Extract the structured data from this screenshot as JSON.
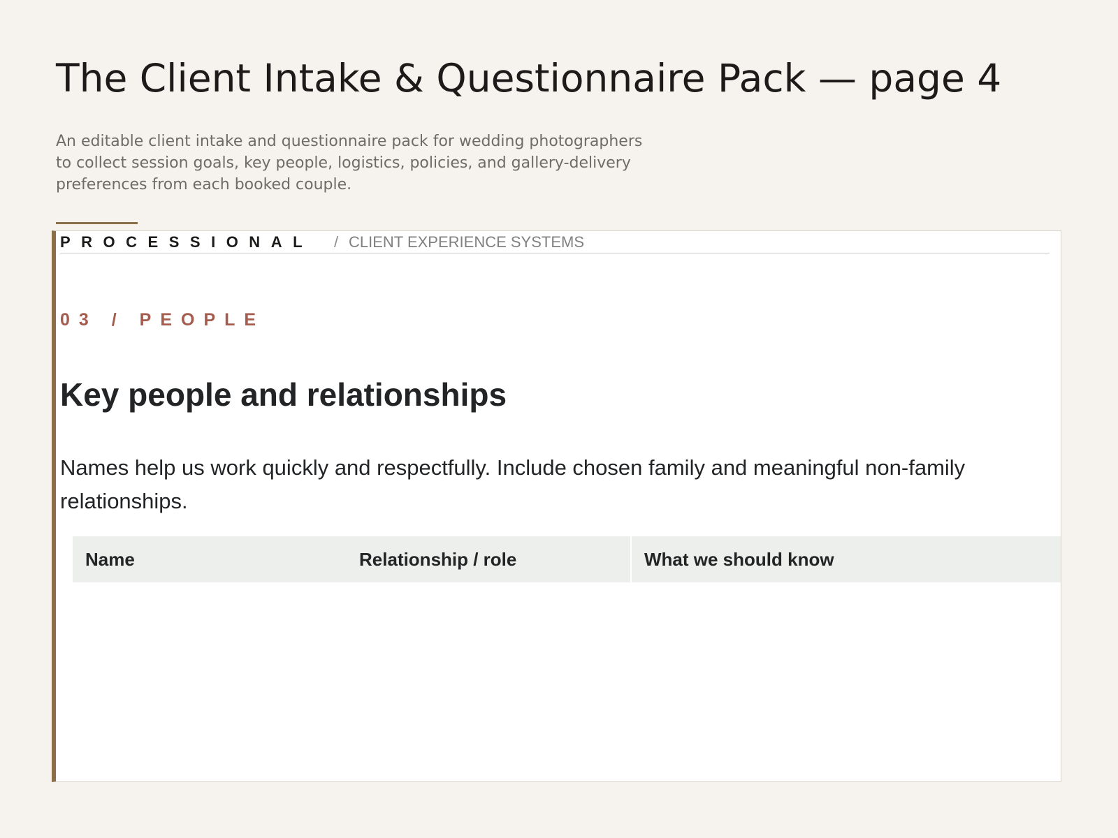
{
  "page": {
    "title": "The Client Intake & Questionnaire Pack — page 4",
    "description": "An editable client intake and questionnaire pack for wedding photographers to collect session goals, key people, logistics, policies, and gallery-delivery preferences from each booked couple."
  },
  "brand": {
    "name": "PROCESSIONAL",
    "separator": "/",
    "tagline": "CLIENT EXPERIENCE SYSTEMS"
  },
  "section": {
    "kicker": "03 / PEOPLE",
    "heading": "Key people and relationships",
    "intro": "Names help us work quickly and respectfully. Include chosen family and meaningful non-family relationships."
  },
  "table": {
    "columns": [
      "Name",
      "Relationship / role",
      "What we should know"
    ]
  },
  "colors": {
    "page_background": "#f6f3ee",
    "accent": "#8c6e48",
    "kicker": "#a45c4e",
    "table_header_background": "#edefec"
  }
}
